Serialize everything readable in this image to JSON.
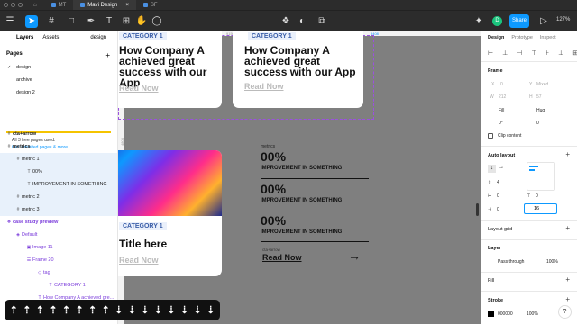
{
  "window": {
    "tabs": [
      {
        "label": "MT"
      },
      {
        "label": "Mavi Design"
      },
      {
        "label": "SF"
      }
    ]
  },
  "toolbar": {
    "share_label": "Share",
    "avatar_initial": "D",
    "zoom": "127%"
  },
  "left_panel": {
    "tabs": [
      "Layers",
      "Assets"
    ],
    "page_selector": "design",
    "pages_title": "Pages",
    "pages": [
      "design",
      "archive",
      "design 2"
    ],
    "notice_line1": "All 3 free pages used.",
    "notice_link": "Get unlimited pages & more",
    "layers": [
      {
        "label": "cta+arrow"
      },
      {
        "label": "metrics"
      },
      {
        "label": "metric 1"
      },
      {
        "label": "00%"
      },
      {
        "label": "IMPROVEMENT IN SOMETHING"
      },
      {
        "label": "metric 2"
      },
      {
        "label": "metric 3"
      },
      {
        "label": "case study preview"
      },
      {
        "label": "Default"
      },
      {
        "label": "Image 11"
      },
      {
        "label": "Frame 20"
      },
      {
        "label": "tag"
      },
      {
        "label": "CATEGORY 1"
      },
      {
        "label": "How Company A achieved gre..."
      }
    ]
  },
  "canvas": {
    "rulers_top": [
      "9000",
      "9050",
      "9100",
      "9150",
      "9184",
      "9250",
      "9300",
      "9350",
      "9408"
    ],
    "rulers_left": [
      "4800",
      "4950",
      "5000",
      "5050"
    ],
    "card_left": {
      "tag": "CATEGORY 1",
      "heading": "How Company A achieved great success with our App",
      "read_now": "Read Now"
    },
    "card_right": {
      "tag": "CATEGORY 1",
      "heading": "How Company A achieved great success with our App",
      "read_now": "Read Now"
    },
    "card_bottom": {
      "tag": "CATEGORY 1",
      "heading": "Title here",
      "read_now": "Read Now"
    },
    "metrics_label": "metrics",
    "metrics": [
      {
        "value": "00%",
        "text": "IMPROVEMENT IN SOMETHING"
      },
      {
        "value": "00%",
        "text": "IMPROVEMENT IN SOMETHING"
      },
      {
        "value": "00%",
        "text": "IMPROVEMENT IN SOMETHING"
      }
    ],
    "cta_label": "cta+arrow",
    "cta_text": "Read Now",
    "cta_arrow": "→"
  },
  "right_panel": {
    "tabs": [
      "Design",
      "Prototype",
      "Inspect"
    ],
    "frame_title": "Frame",
    "x_label": "X",
    "x_value": "0",
    "y_label": "Y",
    "y_value": "Mixed",
    "w_label": "W",
    "w_value": "212",
    "h_label": "H",
    "h_value": "57",
    "fill_label": "Fill",
    "hug_label": "Hug",
    "rotation": "0°",
    "radius": "0",
    "clip_label": "Clip content",
    "auto_layout_title": "Auto layout",
    "spacing_value": "4",
    "pad_h": "0",
    "pad_v": "0",
    "pad_left": "0",
    "pad_right": "0",
    "gap_value": "16",
    "layout_grid_title": "Layout grid",
    "layer_title": "Layer",
    "blend_mode": "Pass through",
    "opacity": "100%",
    "fill_title": "Fill",
    "stroke_title": "Stroke",
    "stroke_color": "000000",
    "stroke_opacity": "100%"
  },
  "keyboard_overlay": [
    "⇡",
    "⇡",
    "⇡",
    "⇡",
    "⇡",
    "⇡",
    "⇡",
    "⇡",
    "⇣",
    "⇣",
    "⇣",
    "⇣",
    "⇣",
    "⇣",
    "⇣",
    "⇣"
  ],
  "help_label": "?"
}
